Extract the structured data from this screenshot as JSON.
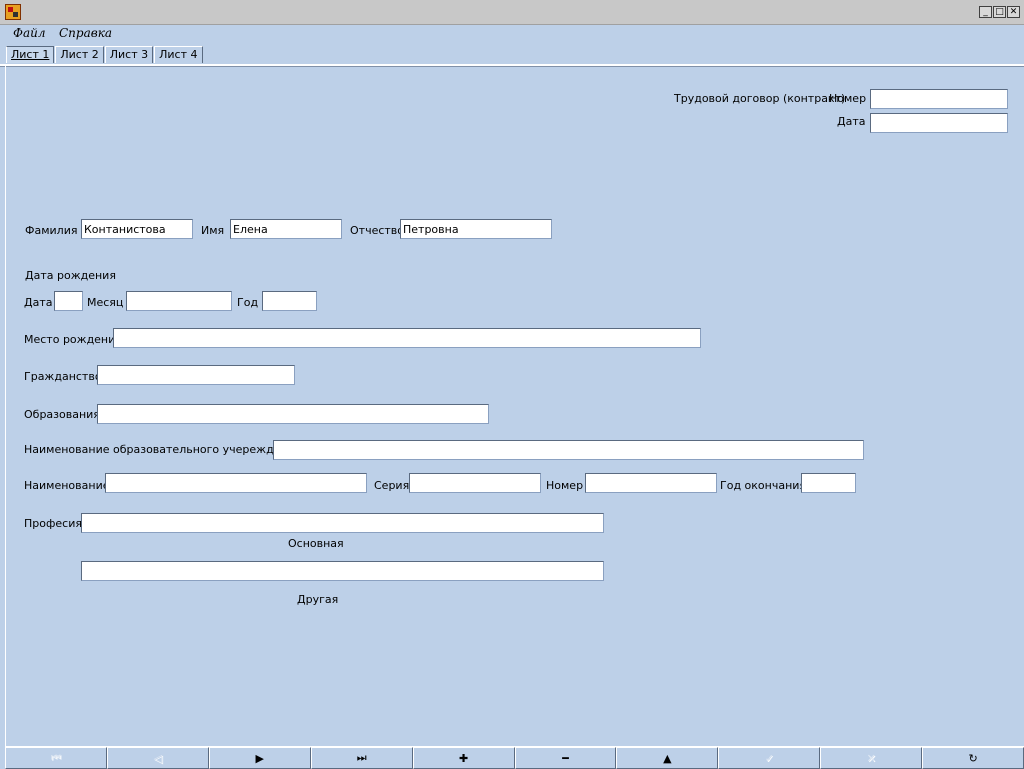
{
  "window": {
    "minimize_glyph": "_",
    "maximize_glyph": "□",
    "close_glyph": "✕"
  },
  "menu": {
    "file": "Файл",
    "help": "Справка"
  },
  "tabs": [
    "Лист 1",
    "Лист 2",
    "Лист 3",
    "Лист 4"
  ],
  "contract": {
    "label": "Трудовой договор (контракт)",
    "number_label": "Номер",
    "number_value": "",
    "date_label": "Дата",
    "date_value": ""
  },
  "person": {
    "surname_label": "Фамилия",
    "surname_value": "Контанистова",
    "name_label": "Имя",
    "name_value": "Елена",
    "patronymic_label": "Отчество",
    "patronymic_value": "Петровна"
  },
  "birth": {
    "section_label": "Дата рождения",
    "day_label": "Дата",
    "day_value": "",
    "month_label": "Месяц",
    "month_value": "",
    "year_label": "Год",
    "year_value": "",
    "place_label": "Место рождения",
    "place_value": ""
  },
  "citizenship": {
    "label": "Гражданство",
    "value": ""
  },
  "education": {
    "label": "Образования",
    "value": "",
    "institution_label": "Наименование образовательного учереждения",
    "institution_value": "",
    "doc_name_label": "Наименование",
    "doc_name_value": "",
    "series_label": "Серия",
    "series_value": "",
    "number_label": "Номер",
    "number_value": "",
    "grad_year_label": "Год окончания",
    "grad_year_value": ""
  },
  "profession": {
    "label": "Професия",
    "main_value": "",
    "main_caption": "Основная",
    "other_value": "",
    "other_caption": "Другая"
  },
  "navigator": {
    "first": "⏮",
    "prior": "◁",
    "next": "▶",
    "last": "⏭",
    "insert": "✚",
    "delete": "━",
    "edit": "▲",
    "post": "✓",
    "cancel": "✕",
    "refresh": "↻"
  }
}
